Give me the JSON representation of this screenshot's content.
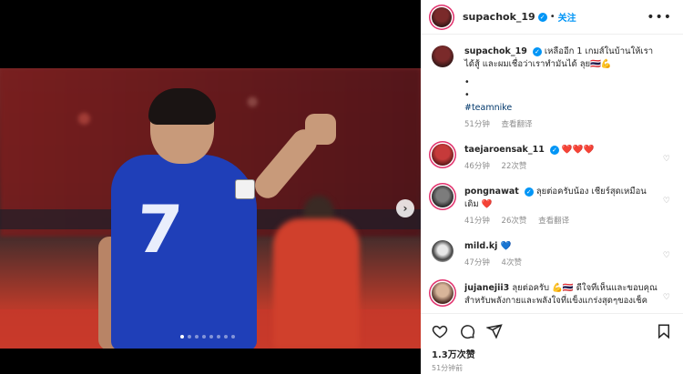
{
  "post": {
    "author": "supachok_19",
    "follow_label": "关注",
    "separator": "•",
    "more_glyph": "•••",
    "carousel_count": 8,
    "carousel_active": 1
  },
  "caption": {
    "username": "supachok_19",
    "text": "เหลืออีก 1 เกมส์ในบ้านให้เราได้สู้ และผมเชื่อว่าเราทำมันได้ ลุย🇹🇭💪",
    "bullet1": "•",
    "bullet2": "•",
    "hashtag": "#teamnike",
    "time": "51分钟",
    "translate": "查看翻译"
  },
  "comments": [
    {
      "username": "taejaroensak_11",
      "text": "❤️❤️❤️",
      "time": "46分钟",
      "likes": "22次赞",
      "translate": ""
    },
    {
      "username": "pongnawat",
      "text": "ลุยต่อครับน้อง เชียร์สุดเหมือนเดิม ❤️",
      "time": "41分钟",
      "likes": "26次赞",
      "translate": "查看翻译"
    },
    {
      "username": "mild.kj",
      "text": "💙",
      "time": "47分钟",
      "likes": "4次赞",
      "translate": ""
    },
    {
      "username": "jujanejii3",
      "text": "ลุยต่อครับ 💪🇹🇭 ดีใจที่เห็นและขอบคุณสำหรับพลังกายและพลังใจที่แข็งแกร่งสุดๆของเช็ค",
      "time": "",
      "likes": "",
      "translate": ""
    }
  ],
  "footer": {
    "likes": "1.3万次赞",
    "ago": "51分钟前"
  },
  "photo": {
    "jersey_number": "7"
  },
  "colors": {
    "accent": "#0095f6",
    "jersey": "#1f3fb8",
    "heart": "#ed4956"
  },
  "icons": {
    "like": "heart-icon",
    "comment": "comment-icon",
    "share": "send-icon",
    "save": "bookmark-icon",
    "next": "chevron-right-icon"
  }
}
